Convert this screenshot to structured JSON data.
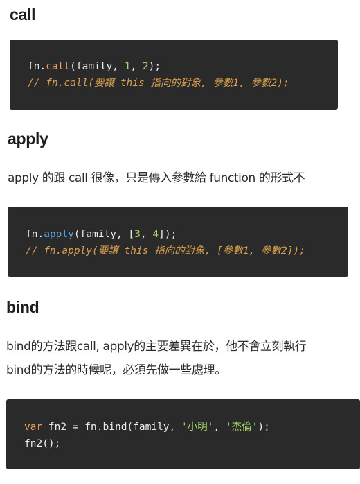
{
  "sections": {
    "call": {
      "heading": "call"
    },
    "apply": {
      "heading": "apply",
      "description": "apply 的跟 call 很像，只是傳入參數給 function 的形式不"
    },
    "bind": {
      "heading": "bind",
      "description_line1": "bind的方法跟call, apply的主要差異在於，他不會立刻執行",
      "description_line2": "bind的方法的時候呢，必須先做一些處理。"
    }
  },
  "code": {
    "call": {
      "l1_obj": "fn",
      "l1_dot": ".",
      "l1_method": "call",
      "l1_open": "(family, ",
      "l1_a": "1",
      "l1_sep": ", ",
      "l1_b": "2",
      "l1_close": ");",
      "l2_comment": "// fn.call(要讓 this 指向的對象, 參數1, 參數2);"
    },
    "apply": {
      "l1_obj": "fn",
      "l1_dot": ".",
      "l1_method": "apply",
      "l1_open": "(family, [",
      "l1_a": "3",
      "l1_sep": ", ",
      "l1_b": "4",
      "l1_close": "]);",
      "l2_comment": "// fn.apply(要讓 this 指向的對象, [參數1, 參數2]);"
    },
    "bind": {
      "l1_kw": "var",
      "l1_rest": " fn2 = fn.bind(family, ",
      "l1_s1": "'小明'",
      "l1_sep": ", ",
      "l1_s2": "'杰倫'",
      "l1_close": ");",
      "l2": "fn2();"
    }
  }
}
